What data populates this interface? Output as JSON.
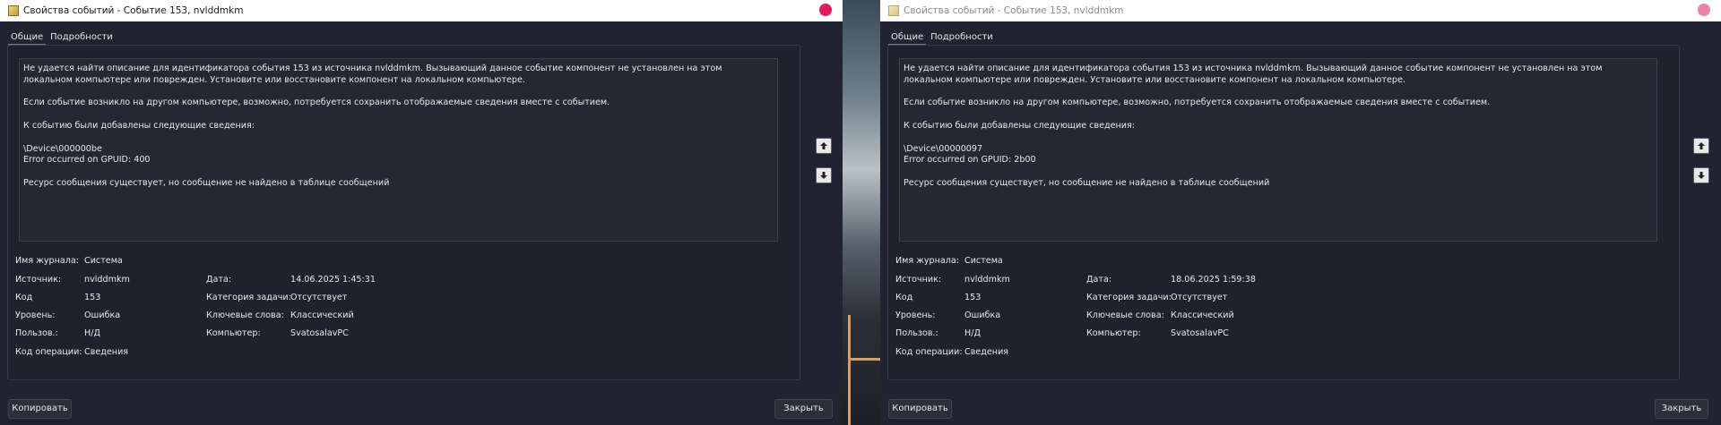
{
  "windows": [
    {
      "title": "Свойства событий - Событие 153, nvlddmkm",
      "tabs": [
        "Общие",
        "Подробности"
      ],
      "description": [
        "Не удается найти описание для идентификатора события 153 из источника nvlddmkm. Вызывающий данное событие компонент не установлен на этом локальном компьютере или поврежден. Установите или восстановите компонент на локальном компьютере.",
        "Если событие возникло на другом компьютере, возможно, потребуется сохранить отображаемые сведения вместе с событием.",
        "К событию были добавлены следующие сведения:",
        "\\Device\\000000be",
        "Error occurred on GPUID: 400",
        "Ресурс сообщения существует, но сообщение не найдено в таблице сообщений"
      ],
      "props": {
        "log_label": "Имя журнала:",
        "log_value": "Система",
        "source_label": "Источник:",
        "source_value": "nvlddmkm",
        "date_label": "Дата:",
        "date_value": "14.06.2025 1:45:31",
        "code_label": "Код",
        "code_value": "153",
        "task_label": "Категория задачи:",
        "task_value": "Отсутствует",
        "level_label": "Уровень:",
        "level_value": "Ошибка",
        "keywords_label": "Ключевые слова:",
        "keywords_value": "Классический",
        "user_label": "Пользов.:",
        "user_value": "Н/Д",
        "computer_label": "Компьютер:",
        "computer_value": "SvatosalavPC",
        "opcode_label": "Код операции:",
        "opcode_value": "Сведения"
      },
      "buttons": {
        "copy": "Копировать",
        "close": "Закрыть"
      }
    },
    {
      "title": "Свойства событий - Событие 153, nvlddmkm",
      "tabs": [
        "Общие",
        "Подробности"
      ],
      "description": [
        "Не удается найти описание для идентификатора события 153 из источника nvlddmkm. Вызывающий данное событие компонент не установлен на этом локальном компьютере или поврежден. Установите или восстановите компонент на локальном компьютере.",
        "Если событие возникло на другом компьютере, возможно, потребуется сохранить отображаемые сведения вместе с событием.",
        "К событию были добавлены следующие сведения:",
        "\\Device\\00000097",
        "Error occurred on GPUID: 2b00",
        "Ресурс сообщения существует, но сообщение не найдено в таблице сообщений"
      ],
      "props": {
        "log_label": "Имя журнала:",
        "log_value": "Система",
        "source_label": "Источник:",
        "source_value": "nvlddmkm",
        "date_label": "Дата:",
        "date_value": "18.06.2025 1:59:38",
        "code_label": "Код",
        "code_value": "153",
        "task_label": "Категория задачи:",
        "task_value": "Отсутствует",
        "level_label": "Уровень:",
        "level_value": "Ошибка",
        "keywords_label": "Ключевые слова:",
        "keywords_value": "Классический",
        "user_label": "Пользов.:",
        "user_value": "Н/Д",
        "computer_label": "Компьютер:",
        "computer_value": "SvatosalavPC",
        "opcode_label": "Код операции:",
        "opcode_value": "Сведения"
      },
      "buttons": {
        "copy": "Копировать",
        "close": "Закрыть"
      }
    }
  ],
  "colors": {
    "window_bg": "#202430",
    "accent_tab": "#5a7bd6",
    "close_dot_active": "#e5195f",
    "close_dot_inactive": "#ec82a5"
  }
}
